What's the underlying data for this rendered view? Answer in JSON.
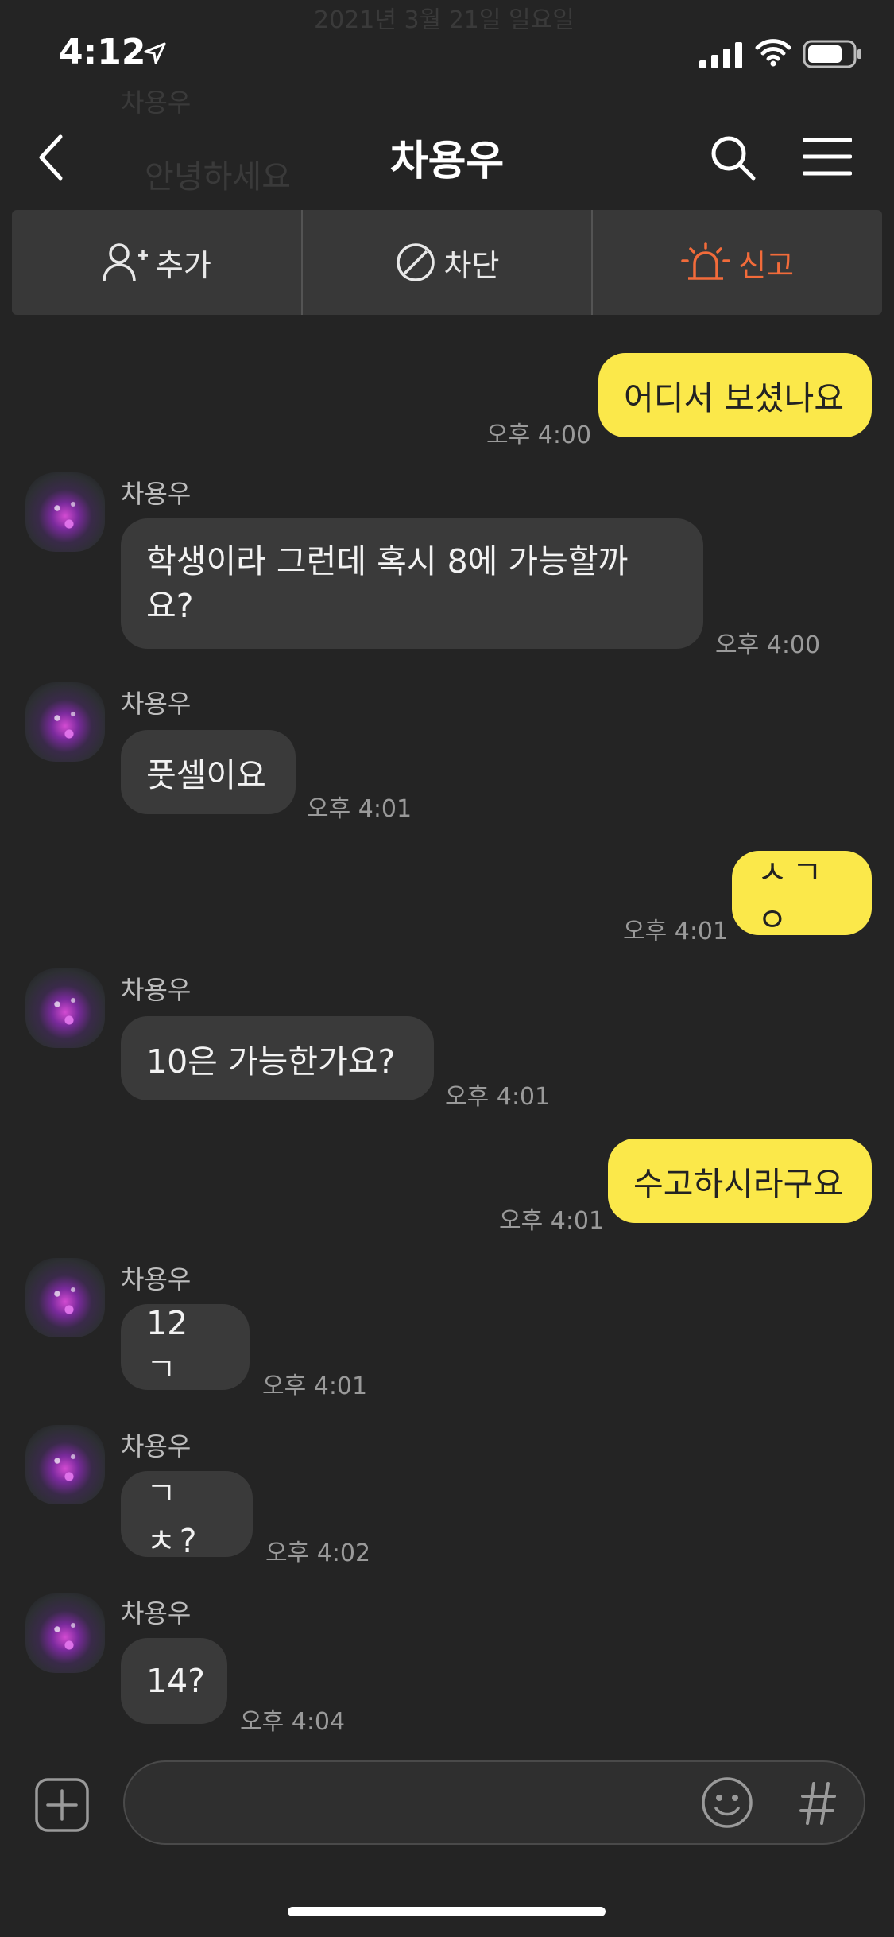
{
  "status_bar": {
    "time": "4:12"
  },
  "background_hint": {
    "date": "2021년 3월 21일 일요일",
    "name": "차용우",
    "message": "안녕하세요"
  },
  "header": {
    "title": "차용우"
  },
  "actions": {
    "add": "추가",
    "block": "차단",
    "report": "신고"
  },
  "messages": [
    {
      "side": "out",
      "text": "어디서 보셨나요",
      "time": "오후 4:00"
    },
    {
      "side": "in",
      "name": "차용우",
      "text": "학생이라 그런데 혹시 8에 가능할까요?",
      "line1": "학생이라 그런데 혹시 8에 가능할까",
      "line2": "요?",
      "time": "오후 4:00"
    },
    {
      "side": "in",
      "name": "차용우",
      "text": "풋셀이요",
      "time": "오후 4:01"
    },
    {
      "side": "out",
      "text": "ㅅㄱㅇ",
      "time": "오후 4:01"
    },
    {
      "side": "in",
      "name": "차용우",
      "text": "10은 가능한가요?",
      "time": "오후 4:01"
    },
    {
      "side": "out",
      "text": "수고하시라구요",
      "time": "오후 4:01"
    },
    {
      "side": "in",
      "name": "차용우",
      "text": "12 ㄱ",
      "time": "오후 4:01"
    },
    {
      "side": "in",
      "name": "차용우",
      "text": "ㄱㅊ?",
      "time": "오후 4:02"
    },
    {
      "side": "in",
      "name": "차용우",
      "text": "14?",
      "time": "오후 4:04"
    }
  ],
  "input": {
    "placeholder": ""
  },
  "colors": {
    "background": "#242424",
    "outgoing_bubble": "#fbe84a",
    "incoming_bubble": "#3a3a3a",
    "report": "#f26b3a"
  }
}
